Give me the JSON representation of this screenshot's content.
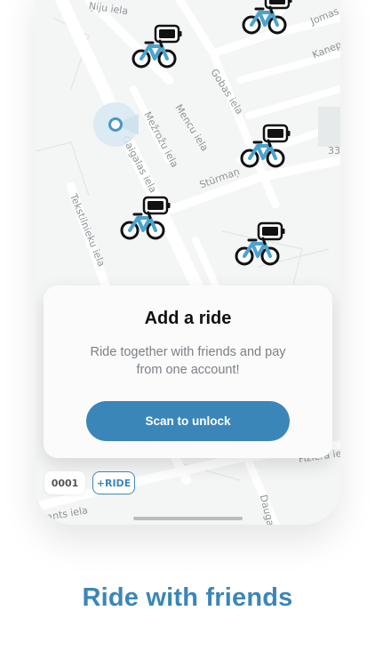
{
  "map": {
    "streets": [
      "Ņiju iela",
      "Jomas iel",
      "Kanepi",
      "Gobas iela",
      "Mežrožu iela",
      "Mencu iela",
      "Gaigalas iela",
      "Stūrmaņ",
      "Tekstilnieku iela",
      "Fiziera iel",
      "Daugav",
      "rants iela",
      "33"
    ]
  },
  "card": {
    "title": "Add a ride",
    "subtitle": "Ride together with friends and pay from one account!",
    "button_label": "Scan to unlock"
  },
  "chips": {
    "code": "0001",
    "ride": "+RIDE"
  },
  "headline": "Ride with friends",
  "colors": {
    "accent": "#3b86b8",
    "bike_frame": "#4aa3cf",
    "map_bg": "#f4f5f5",
    "street": "#ffffff"
  },
  "icons": [
    "bike-icon",
    "battery-icon",
    "location-icon"
  ]
}
